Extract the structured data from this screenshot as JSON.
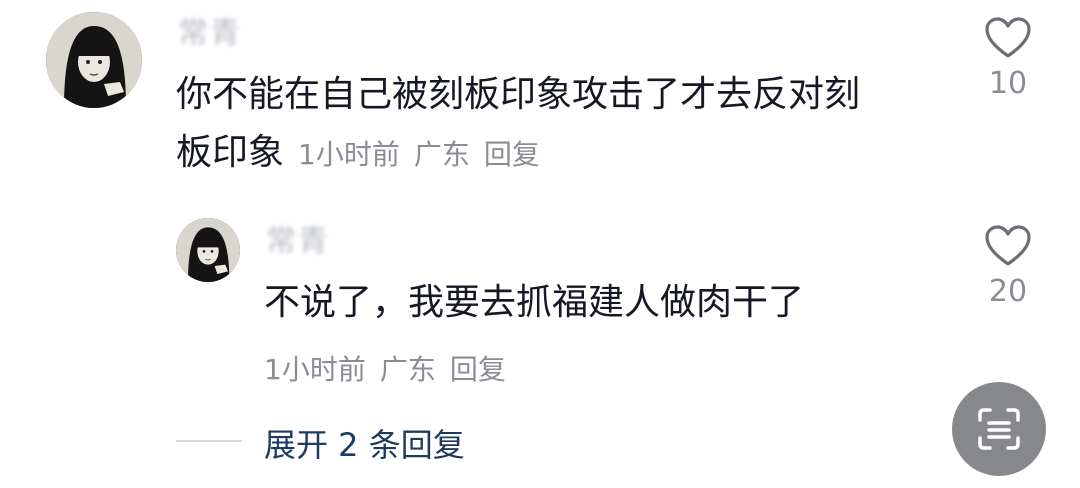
{
  "comments": [
    {
      "username": "常青",
      "text": "你不能在自己被刻板印象攻击了才去反对刻板印象",
      "text_line1": "你不能在自己被刻板印象攻击了才去反对刻",
      "text_line2": "板印象",
      "time": "1小时前",
      "location": "广东",
      "reply_label": "回复",
      "likes": "10"
    },
    {
      "username": "常青",
      "text": "不说了，我要去抓福建人做肉干了",
      "time": "1小时前",
      "location": "广东",
      "reply_label": "回复",
      "likes": "20"
    }
  ],
  "expand_replies": "展开 2 条回复",
  "icons": {
    "like": "heart-outline-icon",
    "fab": "scan-text-icon"
  },
  "colors": {
    "text": "#161823",
    "meta": "#8a8d94",
    "expand": "#1e3a5f"
  }
}
